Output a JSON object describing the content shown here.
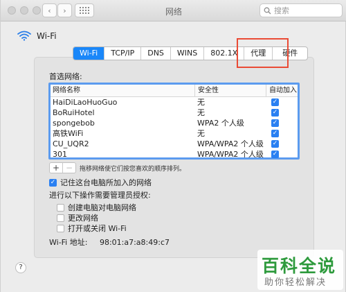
{
  "window": {
    "title": "网络"
  },
  "search": {
    "placeholder": "搜索"
  },
  "wifi": {
    "label": "Wi-Fi"
  },
  "tabs": [
    "Wi-Fi",
    "TCP/IP",
    "DNS",
    "WINS",
    "802.1X",
    "代理",
    "硬件"
  ],
  "preferred": {
    "heading": "首选网络:",
    "columns": [
      "网络名称",
      "安全性",
      "自动加入"
    ],
    "rows": [
      {
        "name": "HaiDiLaoHuoGuo",
        "security": "无"
      },
      {
        "name": "BoRuiHotel",
        "security": "无"
      },
      {
        "name": "spongebob",
        "security": "WPA2 个人级"
      },
      {
        "name": "高铁WiFi",
        "security": "无"
      },
      {
        "name": "CU_UQR2",
        "security": "WPA/WPA2 个人级"
      },
      {
        "name": "301",
        "security": "WPA/WPA2 个人级"
      }
    ],
    "drag_hint": "拖移网络使它们按您喜欢的顺序排列。"
  },
  "buttons": {
    "add": "+",
    "remove": "−",
    "help": "?"
  },
  "remember": {
    "label": "记住这台电脑所加入的网络",
    "checked": true
  },
  "admin": {
    "heading": "进行以下操作需要管理员授权:",
    "options": [
      "创建电脑对电脑网络",
      "更改网络",
      "打开或关闭 Wi-Fi"
    ]
  },
  "mac": {
    "label": "Wi-Fi 地址:",
    "value": "98:01:a7:a8:49:c7"
  },
  "watermark": {
    "big": "百科全说",
    "small": "助你轻松解决"
  },
  "colors": {
    "accent": "#1a87f9",
    "annotation": "#ea4a34",
    "watermark": "#2d9a3c"
  }
}
